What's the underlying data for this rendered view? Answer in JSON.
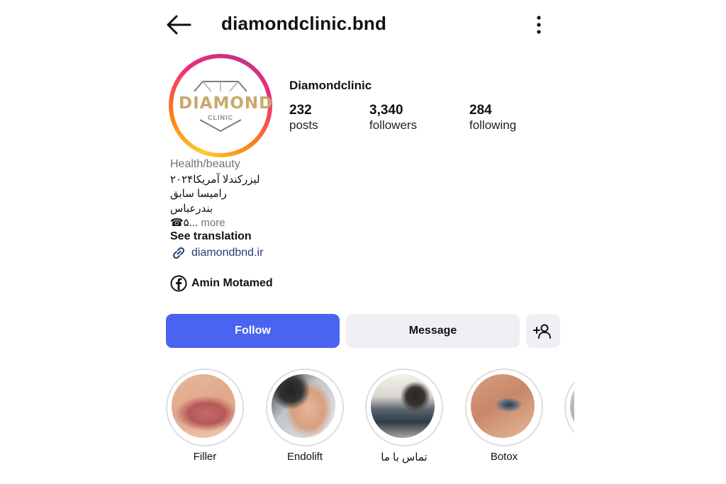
{
  "header": {
    "username": "diamondclinic.bnd",
    "back_icon": "arrow-left-icon",
    "more_icon": "vertical-dots-icon"
  },
  "profile": {
    "avatar_logo_text": "DIAMOND",
    "avatar_logo_subtext": "CLINIC",
    "display_name": "Diamondclinic",
    "stats": [
      {
        "value": "232",
        "label": "posts"
      },
      {
        "value": "3,340",
        "label": "followers"
      },
      {
        "value": "284",
        "label": "following"
      }
    ],
    "category": "Health/beauty",
    "bio_lines": [
      "لیزرکندلا آمریکا۲۰۲۴",
      "رامیسا سابق",
      "بندرعباس"
    ],
    "bio_phone_prefix": "☎۵...",
    "bio_more": "more",
    "see_translation": "See translation",
    "website": "diamondbnd.ir",
    "facebook_name": "Amin Motamed"
  },
  "actions": {
    "follow_label": "Follow",
    "message_label": "Message",
    "add_user_icon": "add-person-icon"
  },
  "highlights": [
    {
      "label": "Filler"
    },
    {
      "label": "Endolift"
    },
    {
      "label": "تماس با ما"
    },
    {
      "label": "Botox"
    }
  ],
  "colors": {
    "follow_button": "#4a63f0",
    "secondary_button": "#eef0f4",
    "link": "#233d7a",
    "muted_text": "#737373"
  }
}
